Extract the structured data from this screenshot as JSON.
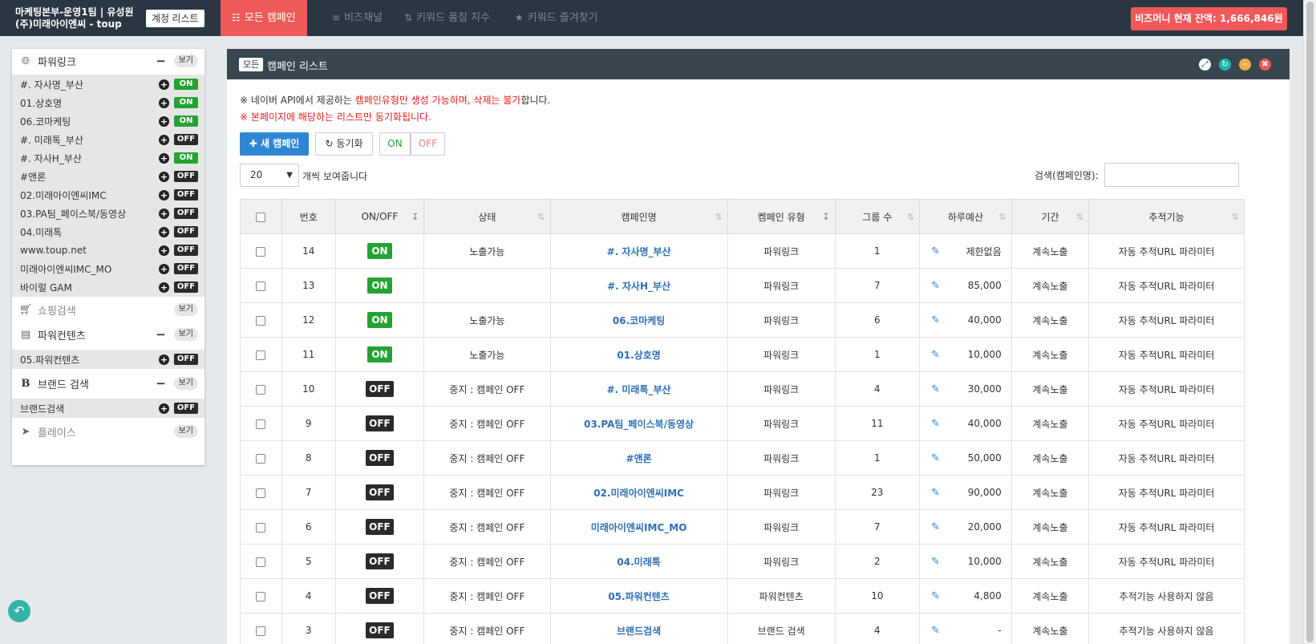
{
  "topbar": {
    "account_line1": "마케팅본부-운영1팀 | 유성원",
    "account_line2": "(주)미래아이엔씨 - toup",
    "account_list_button": "계정 리스트",
    "tabs": [
      {
        "icon": "sitemap-icon",
        "label": "모든 캠페인",
        "active": true
      },
      {
        "icon": "sliders-icon",
        "label": "비즈채널",
        "active": false
      },
      {
        "icon": "sort-numeric-icon",
        "label": "키워드 품질 지수",
        "active": false
      },
      {
        "icon": "star-icon",
        "label": "키워드 즐겨찾기",
        "active": false
      }
    ],
    "balance": "비즈머니 현재 잔액: 1,666,846원"
  },
  "sidebar": {
    "view_label": "보기",
    "groups": [
      {
        "name": "파워링크",
        "icon": "globe-icon",
        "collapsible": true,
        "items": [
          {
            "label": "#. 자사명_부산",
            "status": "ON"
          },
          {
            "label": "01.상호명",
            "status": "ON"
          },
          {
            "label": "06.코마케팅",
            "status": "ON"
          },
          {
            "label": "#. 미래톡_부산",
            "status": "OFF"
          },
          {
            "label": "#. 자사H_부산",
            "status": "ON"
          },
          {
            "label": "#앤론",
            "status": "OFF"
          },
          {
            "label": "02.미래아이엔씨IMC",
            "status": "OFF"
          },
          {
            "label": "03.PA팀_페이스북/동영상",
            "status": "OFF"
          },
          {
            "label": "04.미래톡",
            "status": "OFF"
          },
          {
            "label": "www.toup.net",
            "status": "OFF"
          },
          {
            "label": "미래아이엔씨IMC_MO",
            "status": "OFF"
          },
          {
            "label": "바이럴 GAM",
            "status": "OFF"
          }
        ]
      },
      {
        "name": "쇼핑검색",
        "icon": "cart-icon",
        "collapsible": false,
        "items": []
      },
      {
        "name": "파워컨텐츠",
        "icon": "newspaper-icon",
        "collapsible": true,
        "items": [
          {
            "label": "05.파워컨텐츠",
            "status": "OFF"
          }
        ]
      },
      {
        "name": "브랜드 검색",
        "icon": "bold-b-icon",
        "collapsible": true,
        "items": [
          {
            "label": "브랜드검색",
            "status": "OFF"
          }
        ]
      },
      {
        "name": "플레이스",
        "icon": "location-arrow-icon",
        "collapsible": false,
        "items": []
      }
    ]
  },
  "panel": {
    "badge": "모든",
    "title": "캠페인 리스트",
    "notice1_pre": "※ 네이버 API에서 제공하는 ",
    "notice1_red": "캠페인유형만 생성 가능하며, 삭제는 불가",
    "notice1_post": "합니다.",
    "notice2": "※ 본페이지에 해당하는 리스트만 동기화됩니다.",
    "new_campaign": "새 캠페인",
    "sync": "동기화",
    "on": "ON",
    "off": "OFF",
    "page_size": "20",
    "per_page_text": "개씩 보여줍니다",
    "search_label": "검색(캠페인명):",
    "search_value": ""
  },
  "table": {
    "headers": [
      "",
      "번호",
      "ON/OFF",
      "상태",
      "캠페인명",
      "켐페인 유형",
      "그룹 수",
      "하루예산",
      "기간",
      "추적기능"
    ],
    "rows": [
      {
        "no": "14",
        "onoff": "ON",
        "status": "노출가능",
        "name": "#. 자사명_부산",
        "type": "파워링크",
        "groups": "1",
        "budget": "제한없음",
        "period": "계속노출",
        "tracking": "자동 추적URL 파라미터"
      },
      {
        "no": "13",
        "onoff": "ON",
        "status": "",
        "name": "#. 자사H_부산",
        "type": "파워링크",
        "groups": "7",
        "budget": "85,000",
        "period": "계속노출",
        "tracking": "자동 추적URL 파라미터"
      },
      {
        "no": "12",
        "onoff": "ON",
        "status": "노출가능",
        "name": "06.코마케팅",
        "type": "파워링크",
        "groups": "6",
        "budget": "40,000",
        "period": "계속노출",
        "tracking": "자동 추적URL 파라미터"
      },
      {
        "no": "11",
        "onoff": "ON",
        "status": "노출가능",
        "name": "01.상호명",
        "type": "파워링크",
        "groups": "1",
        "budget": "10,000",
        "period": "계속노출",
        "tracking": "자동 추적URL 파라미터"
      },
      {
        "no": "10",
        "onoff": "OFF",
        "status": "중지 : 캠페인 OFF",
        "name": "#. 미래톡_부산",
        "type": "파워링크",
        "groups": "4",
        "budget": "30,000",
        "period": "계속노출",
        "tracking": "자동 추적URL 파라미터"
      },
      {
        "no": "9",
        "onoff": "OFF",
        "status": "중지 : 캠페인 OFF",
        "name": "03.PA팀_페이스북/동영상",
        "type": "파워링크",
        "groups": "11",
        "budget": "40,000",
        "period": "계속노출",
        "tracking": "자동 추적URL 파라미터"
      },
      {
        "no": "8",
        "onoff": "OFF",
        "status": "중지 : 캠페인 OFF",
        "name": "#앤론",
        "type": "파워링크",
        "groups": "1",
        "budget": "50,000",
        "period": "계속노출",
        "tracking": "자동 추적URL 파라미터"
      },
      {
        "no": "7",
        "onoff": "OFF",
        "status": "중지 : 캠페인 OFF",
        "name": "02.미래아이엔씨IMC",
        "type": "파워링크",
        "groups": "23",
        "budget": "90,000",
        "period": "계속노출",
        "tracking": "자동 추적URL 파라미터"
      },
      {
        "no": "6",
        "onoff": "OFF",
        "status": "중지 : 캠페인 OFF",
        "name": "미래아이엔씨IMC_MO",
        "type": "파워링크",
        "groups": "7",
        "budget": "20,000",
        "period": "계속노출",
        "tracking": "자동 추적URL 파라미터"
      },
      {
        "no": "5",
        "onoff": "OFF",
        "status": "중지 : 캠페인 OFF",
        "name": "04.미래톡",
        "type": "파워링크",
        "groups": "2",
        "budget": "10,000",
        "period": "계속노출",
        "tracking": "자동 추적URL 파라미터"
      },
      {
        "no": "4",
        "onoff": "OFF",
        "status": "중지 : 캠페인 OFF",
        "name": "05.파워컨텐츠",
        "type": "파워컨텐츠",
        "groups": "10",
        "budget": "4,800",
        "period": "계속노출",
        "tracking": "추적기능 사용하지 않음"
      },
      {
        "no": "3",
        "onoff": "OFF",
        "status": "중지 : 캠페인 OFF",
        "name": "브랜드검색",
        "type": "브랜드 검색",
        "groups": "4",
        "budget": "-",
        "period": "계속노출",
        "tracking": "추적기능 사용하지 않음"
      }
    ]
  },
  "colors": {
    "accent_red": "#ef5959",
    "on_green": "#26a234",
    "off_dark": "#2b2b2b",
    "link_blue": "#2f6fb5",
    "topbar_bg": "#2b3643"
  }
}
